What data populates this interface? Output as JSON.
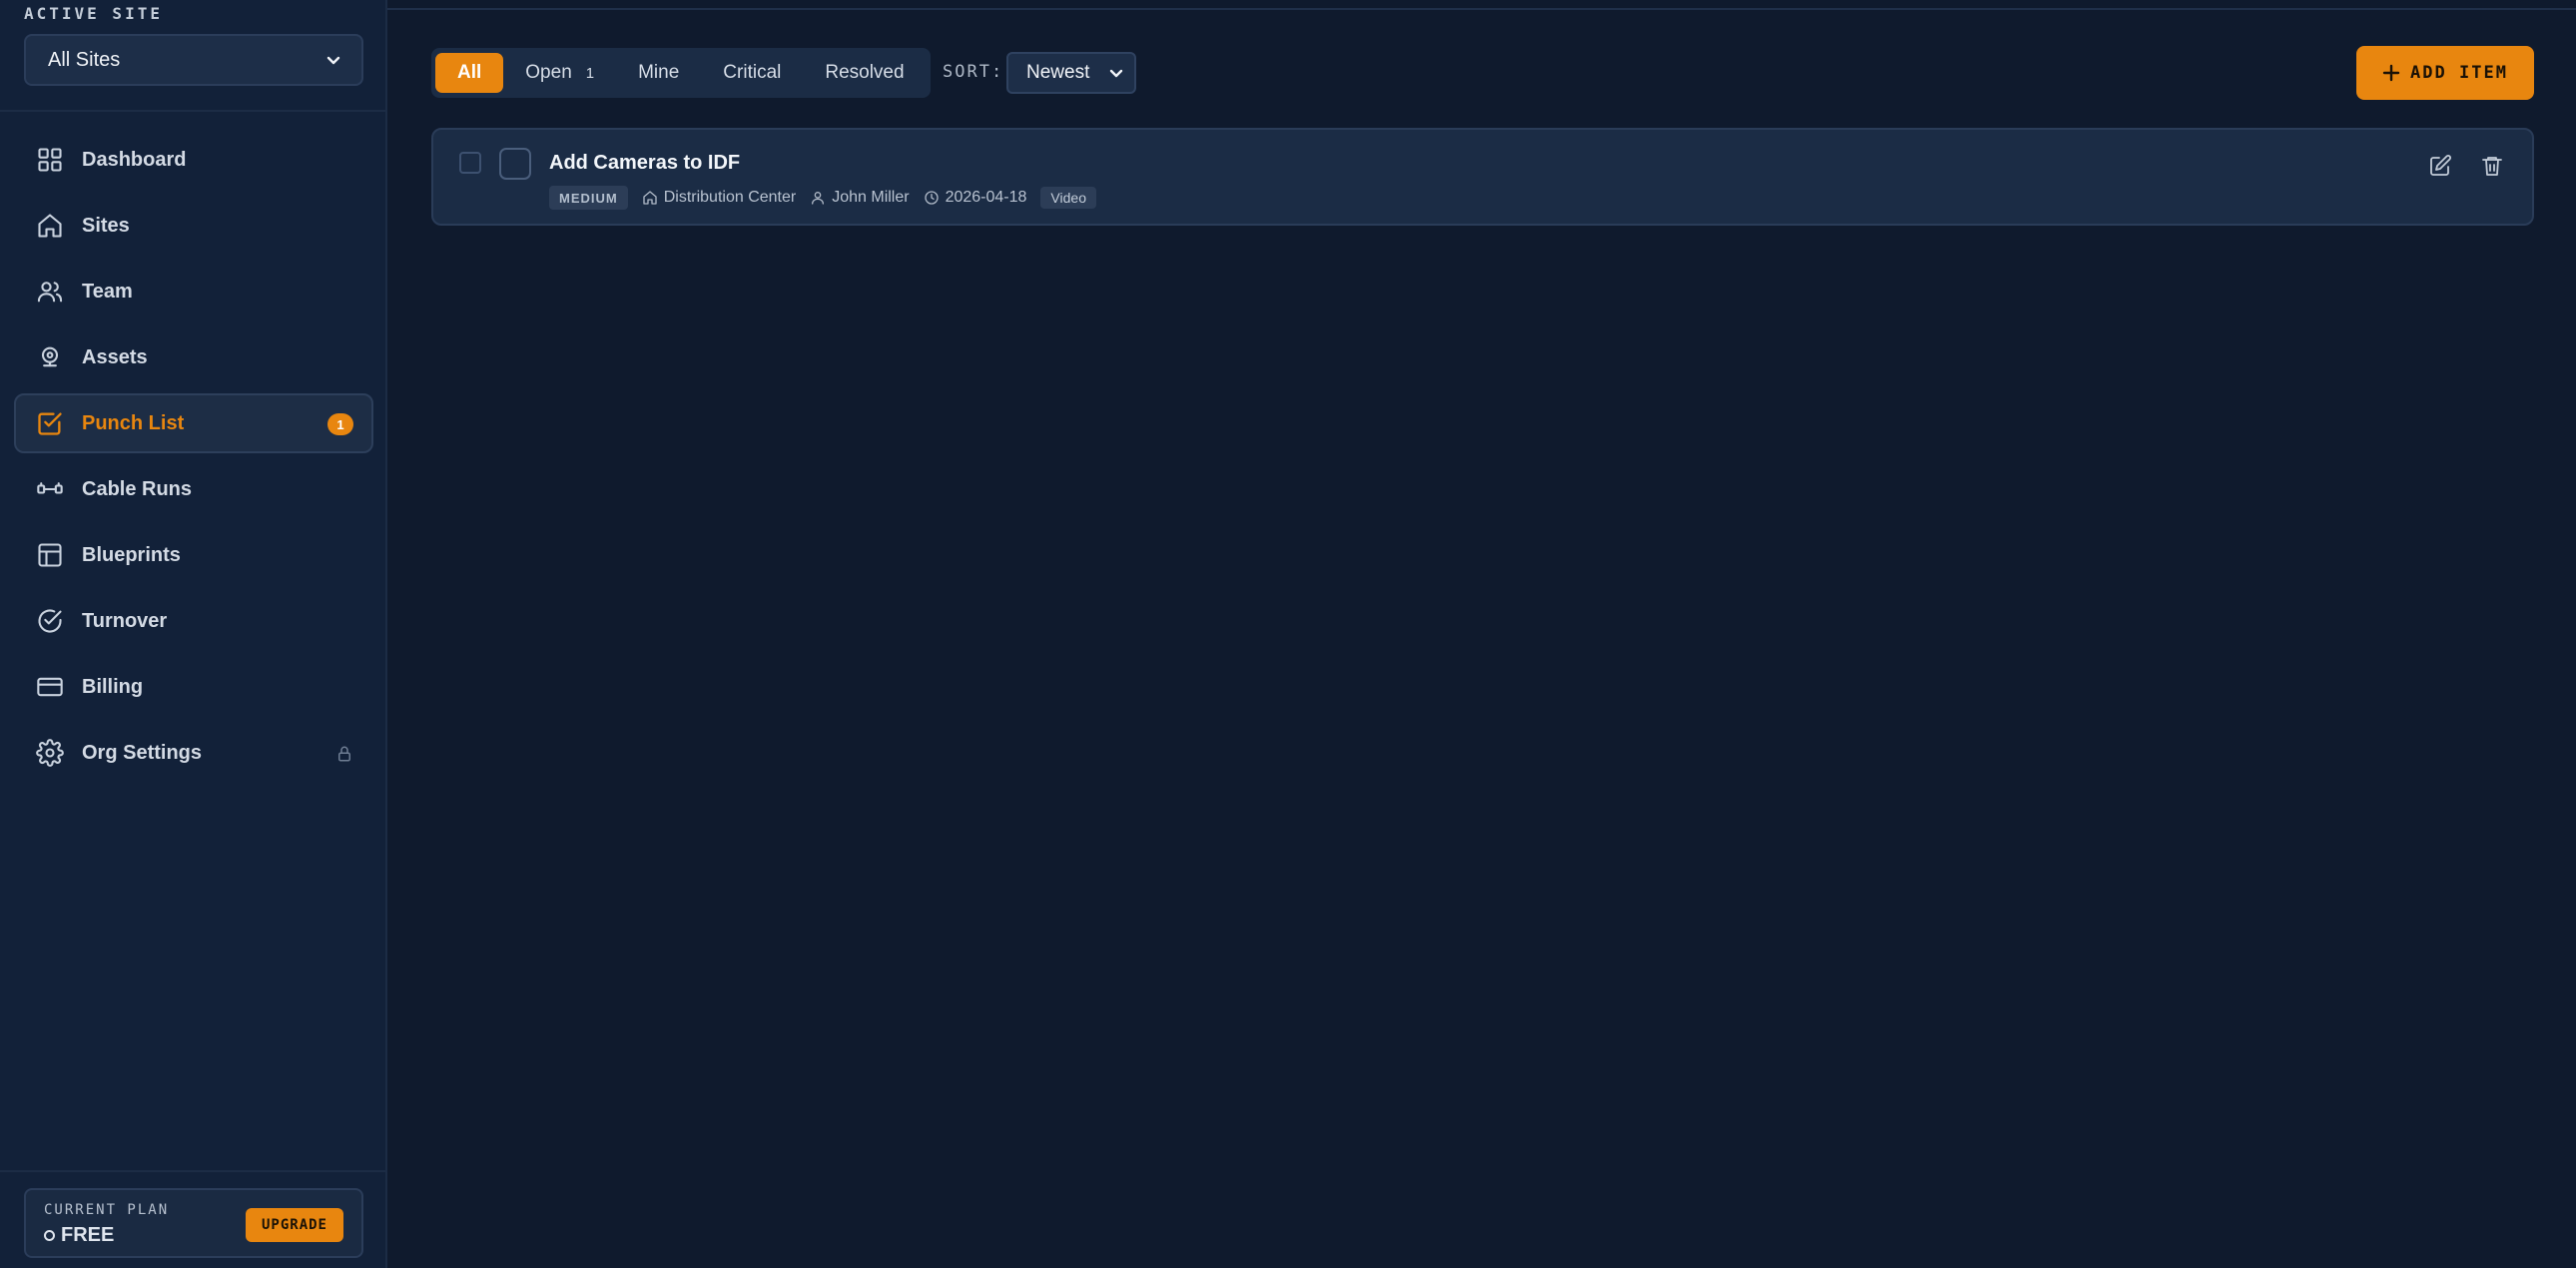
{
  "sidebar": {
    "site_label": "ACTIVE SITE",
    "site_value": "All Sites",
    "items": [
      {
        "label": "Dashboard",
        "icon": "grid-icon"
      },
      {
        "label": "Sites",
        "icon": "home-icon"
      },
      {
        "label": "Team",
        "icon": "users-icon"
      },
      {
        "label": "Assets",
        "icon": "camera-icon"
      },
      {
        "label": "Punch List",
        "icon": "checkbox-icon",
        "active": true,
        "badge": "1"
      },
      {
        "label": "Cable Runs",
        "icon": "cable-icon"
      },
      {
        "label": "Blueprints",
        "icon": "blueprint-icon"
      },
      {
        "label": "Turnover",
        "icon": "check-circle-icon"
      },
      {
        "label": "Billing",
        "icon": "credit-card-icon"
      },
      {
        "label": "Org Settings",
        "icon": "gear-icon",
        "locked": true
      }
    ],
    "plan": {
      "label": "CURRENT PLAN",
      "value": "FREE",
      "upgrade": "UPGRADE"
    }
  },
  "toolbar": {
    "tabs": [
      {
        "label": "All",
        "active": true
      },
      {
        "label": "Open",
        "count": "1"
      },
      {
        "label": "Mine"
      },
      {
        "label": "Critical"
      },
      {
        "label": "Resolved"
      }
    ],
    "sort_label": "SORT:",
    "sort_value": "Newest",
    "add_label": "ADD ITEM"
  },
  "items": [
    {
      "title": "Add Cameras to IDF",
      "priority": "MEDIUM",
      "site": "Distribution Center",
      "assignee": "John Miller",
      "date": "2026-04-18",
      "tag": "Video"
    }
  ],
  "colors": {
    "accent": "#e8860f",
    "background": "#0f1a2d",
    "sidebar": "#122139",
    "card": "#1b2c45"
  }
}
